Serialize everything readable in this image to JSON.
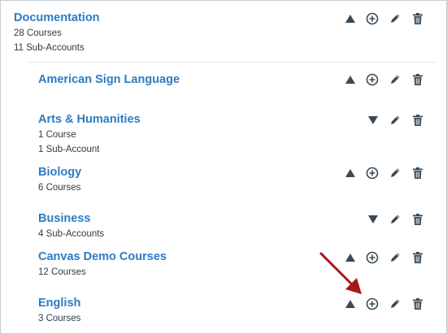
{
  "accounts": [
    {
      "name": "Documentation",
      "line1": "28 Courses",
      "line2": "11 Sub-Accounts",
      "toggle": "collapse",
      "can_add": true
    },
    {
      "name": "American Sign Language",
      "line1": "",
      "line2": "",
      "toggle": "collapse",
      "can_add": true
    },
    {
      "name": "Arts & Humanities",
      "line1": "1 Course",
      "line2": "1 Sub-Account",
      "toggle": "expand",
      "can_add": false
    },
    {
      "name": "Biology",
      "line1": "6 Courses",
      "line2": "",
      "toggle": "collapse",
      "can_add": true
    },
    {
      "name": "Business",
      "line1": "4 Sub-Accounts",
      "line2": "",
      "toggle": "expand",
      "can_add": false
    },
    {
      "name": "Canvas Demo Courses",
      "line1": "12 Courses",
      "line2": "",
      "toggle": "collapse",
      "can_add": true
    },
    {
      "name": "English",
      "line1": "3 Courses",
      "line2": "",
      "toggle": "collapse",
      "can_add": true
    }
  ],
  "icons": {
    "collapse": "triangle-up-icon",
    "expand": "triangle-down-icon",
    "add": "add-circle-icon",
    "edit": "pencil-icon",
    "delete": "trash-icon",
    "annotation": "red-arrow-annotation"
  },
  "colors": {
    "link": "#2d7bc4",
    "text": "#2d3b45",
    "icon": "#394b58",
    "annotation": "#a8161c"
  }
}
